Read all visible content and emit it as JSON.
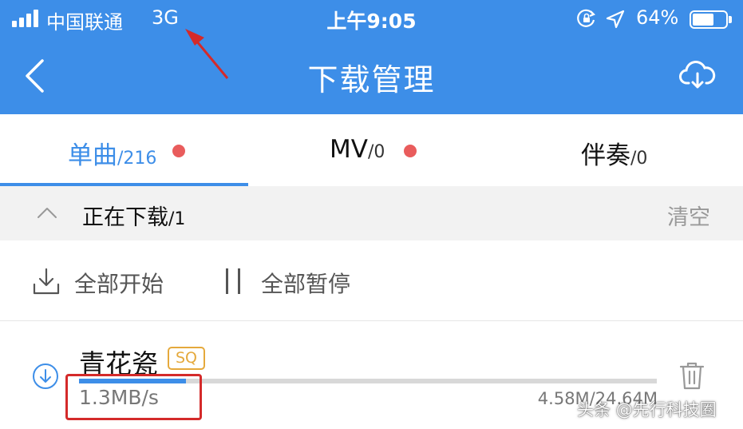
{
  "status_bar": {
    "carrier": "中国联通",
    "network": "3G",
    "time": "上午9:05",
    "battery_pct_label": "64%",
    "battery_level": 0.64
  },
  "nav": {
    "title": "下载管理",
    "back_icon": "chevron-left-icon",
    "right_icon": "cloud-download-icon"
  },
  "tabs": [
    {
      "label": "单曲",
      "count": "/216",
      "active": true,
      "has_dot": true
    },
    {
      "label": "MV",
      "count": "/0",
      "active": false,
      "has_dot": true
    },
    {
      "label": "伴奏",
      "count": "/0",
      "active": false,
      "has_dot": false
    }
  ],
  "section": {
    "title": "正在下载",
    "count": "/1",
    "clear_label": "清空"
  },
  "actions": {
    "start_all": "全部开始",
    "pause_all": "全部暂停"
  },
  "song": {
    "name": "青花瓷",
    "quality_badge": "SQ",
    "speed": "1.3MB/s",
    "size": "4.58M/24.64M",
    "progress": 0.185
  },
  "watermark": "头条 @先行科技圈",
  "colors": {
    "accent": "#3D8EE8",
    "dot": "#E95C5C",
    "badge": "#E5A93C",
    "annotation": "#D42A2A"
  }
}
